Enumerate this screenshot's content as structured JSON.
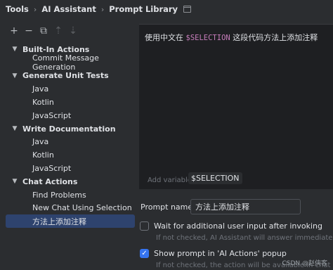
{
  "breadcrumb": [
    "Tools",
    "AI Assistant",
    "Prompt Library"
  ],
  "toolbar": {
    "add": "+",
    "remove": "−",
    "copy": "⧉",
    "move_up": "⇡",
    "move_down": "⇣"
  },
  "tree": {
    "groups": [
      {
        "label": "Built-In Actions",
        "items": [
          "Commit Message Generation"
        ]
      },
      {
        "label": "Generate Unit Tests",
        "items": [
          "Java",
          "Kotlin",
          "JavaScript"
        ]
      },
      {
        "label": "Write Documentation",
        "items": [
          "Java",
          "Kotlin",
          "JavaScript"
        ]
      },
      {
        "label": "Chat Actions",
        "items": [
          "Find Problems",
          "New Chat Using Selection",
          "方法上添加注释"
        ]
      }
    ],
    "selected": "方法上添加注释"
  },
  "editor": {
    "text_before": "使用中文在",
    "variable": "$SELECTION",
    "text_after": "这段代码方法上添加注释",
    "add_variable_label": "Add variable:",
    "add_variable_button": "$SELECTION"
  },
  "prompt_name": {
    "label": "Prompt name:",
    "value": "方法上添加注释"
  },
  "options": {
    "wait_label": "Wait for additional user input after invoking",
    "wait_checked": false,
    "wait_hint": "If not checked, AI Assistant will answer immediately",
    "show_label": "Show prompt in 'AI Actions' popup",
    "show_checked": true,
    "show_hint": "If not checked, the action will be available in chat only"
  },
  "watermark": "CSDN @赵侠客",
  "colors": {
    "accent": "#3574f0",
    "selection": "#2e436e",
    "variable": "#c77dbb"
  }
}
